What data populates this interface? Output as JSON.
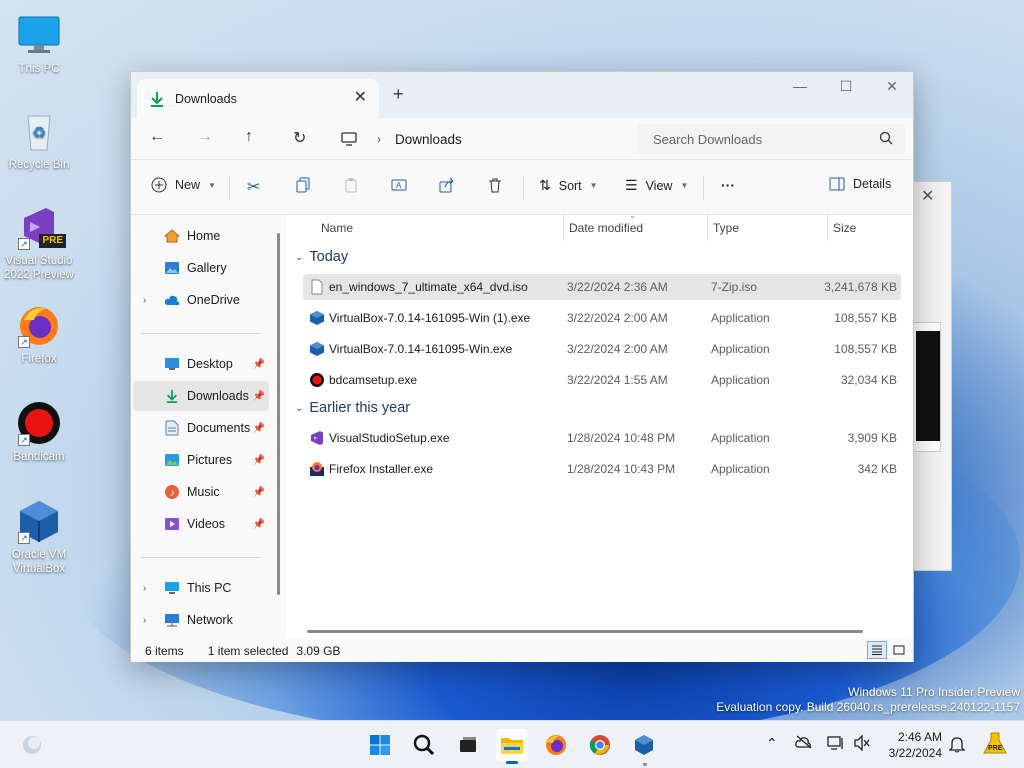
{
  "desktop": {
    "icons": [
      {
        "label": "This PC"
      },
      {
        "label": "Recycle Bin"
      },
      {
        "label": "Visual Studio 2022 Preview",
        "badge": "PRE"
      },
      {
        "label": "Firefox"
      },
      {
        "label": "Bandicam"
      },
      {
        "label": "Oracle VM VirtualBox"
      }
    ],
    "watermark": {
      "line1": "Windows 11 Pro Insider Preview",
      "line2": "Evaluation copy. Build 26040.rs_prerelease.240122-1157"
    }
  },
  "explorer": {
    "tab_title": "Downloads",
    "new_tab": "+",
    "window_controls": {
      "minimize": "—",
      "maximize": "☐",
      "close": "✕"
    },
    "breadcrumb": "Downloads",
    "search_placeholder": "Search Downloads",
    "commands": {
      "new": "New",
      "sort": "Sort",
      "view": "View",
      "more": "···",
      "details": "Details"
    },
    "nav": {
      "home": "Home",
      "gallery": "Gallery",
      "onedrive": "OneDrive",
      "desktop": "Desktop",
      "downloads": "Downloads",
      "documents": "Documents",
      "pictures": "Pictures",
      "music": "Music",
      "videos": "Videos",
      "thispc": "This PC",
      "network": "Network"
    },
    "columns": {
      "name": "Name",
      "date": "Date modified",
      "type": "Type",
      "size": "Size"
    },
    "groups": {
      "today": {
        "label": "Today",
        "files": [
          {
            "name": "en_windows_7_ultimate_x64_dvd.iso",
            "date": "3/22/2024 2:36 AM",
            "type": "7-Zip.iso",
            "size": "3,241,678 KB",
            "icon": "iso-file-icon"
          },
          {
            "name": "VirtualBox-7.0.14-161095-Win (1).exe",
            "date": "3/22/2024 2:00 AM",
            "type": "Application",
            "size": "108,557 KB",
            "icon": "virtualbox-icon"
          },
          {
            "name": "VirtualBox-7.0.14-161095-Win.exe",
            "date": "3/22/2024 2:00 AM",
            "type": "Application",
            "size": "108,557 KB",
            "icon": "virtualbox-icon"
          },
          {
            "name": "bdcamsetup.exe",
            "date": "3/22/2024 1:55 AM",
            "type": "Application",
            "size": "32,034 KB",
            "icon": "bandicam-icon"
          }
        ]
      },
      "earlier": {
        "label": "Earlier this year",
        "files": [
          {
            "name": "VisualStudioSetup.exe",
            "date": "1/28/2024 10:48 PM",
            "type": "Application",
            "size": "3,909 KB",
            "icon": "visual-studio-icon"
          },
          {
            "name": "Firefox Installer.exe",
            "date": "1/28/2024 10:43 PM",
            "type": "Application",
            "size": "342 KB",
            "icon": "firefox-installer-icon"
          }
        ]
      }
    },
    "status": {
      "items": "6 items",
      "selected": "1 item selected",
      "size": "3.09 GB"
    }
  },
  "taskbar": {
    "time": "2:46 AM",
    "date": "3/22/2024",
    "pre_badge": "PRE"
  }
}
